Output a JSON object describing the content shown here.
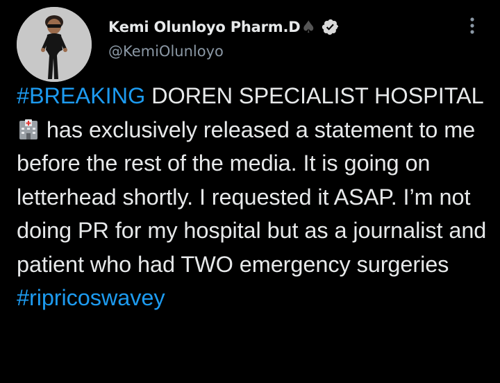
{
  "author": {
    "display_name": "Kemi Olunloyo Pharm.D",
    "name_emoji": "♠",
    "handle": "@KemiOlunloyo",
    "verified": true
  },
  "icons": {
    "avatar": "avatar-image",
    "verified": "verified-badge-icon",
    "more": "more-options-icon",
    "emoji": "hospital-emoji"
  },
  "tweet": {
    "hashtag_1": "#BREAKING",
    "text_1": " DOREN SPECIALIST HOSPITAL ",
    "text_2": " has exclusively released a statement to me before the rest of the media. It is going on letterhead shortly. I requested it ASAP. I’m not doing PR for my hospital but as a journalist and patient who had TWO emergency surgeries",
    "hashtag_2": "#ripricoswavey"
  },
  "colors": {
    "background": "#000000",
    "text": "#e7e9ea",
    "secondary": "#8b98a5",
    "link": "#1d9bf0"
  }
}
